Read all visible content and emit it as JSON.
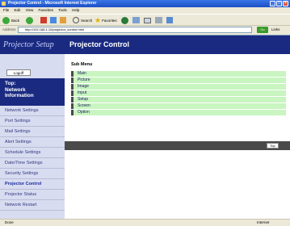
{
  "window": {
    "title": "Projector Control - Microsoft Internet Explorer"
  },
  "menu": [
    "File",
    "Edit",
    "View",
    "Favorites",
    "Tools",
    "Help"
  ],
  "toolbar": {
    "back": "Back",
    "search": "Search",
    "favorites": "Favorites"
  },
  "address": {
    "label": "Address",
    "url": "http://192.168.1.10/projector_control.html",
    "go": "Go",
    "links": "Links"
  },
  "sidebar": {
    "logo": "Projector Setup",
    "logoff": "Logoff",
    "top_lines": [
      "Top:",
      "Network",
      "Information"
    ],
    "items": [
      "Network Settings",
      "Port Settings",
      "Mail Settings",
      "Alert Settings",
      "Schedule Settings",
      "Date/Time Settings",
      "Security Settings",
      "Projector Control",
      "Projector Status",
      "Network Restart"
    ]
  },
  "main": {
    "title": "Projector Control",
    "submenu_title": "Sub Menu",
    "submenu": [
      "Main",
      "Picture",
      "Image",
      "Input",
      "Setup",
      "Screen",
      "Option"
    ],
    "top_button": "Top"
  },
  "status": {
    "left": "Done",
    "right": "Internet"
  },
  "colors": {
    "nav_bg": "#1a2a80",
    "sidebar_bg": "#d8dcf0",
    "submenu_bg": "#c8f5c0",
    "bar": "#4a4a4a"
  }
}
